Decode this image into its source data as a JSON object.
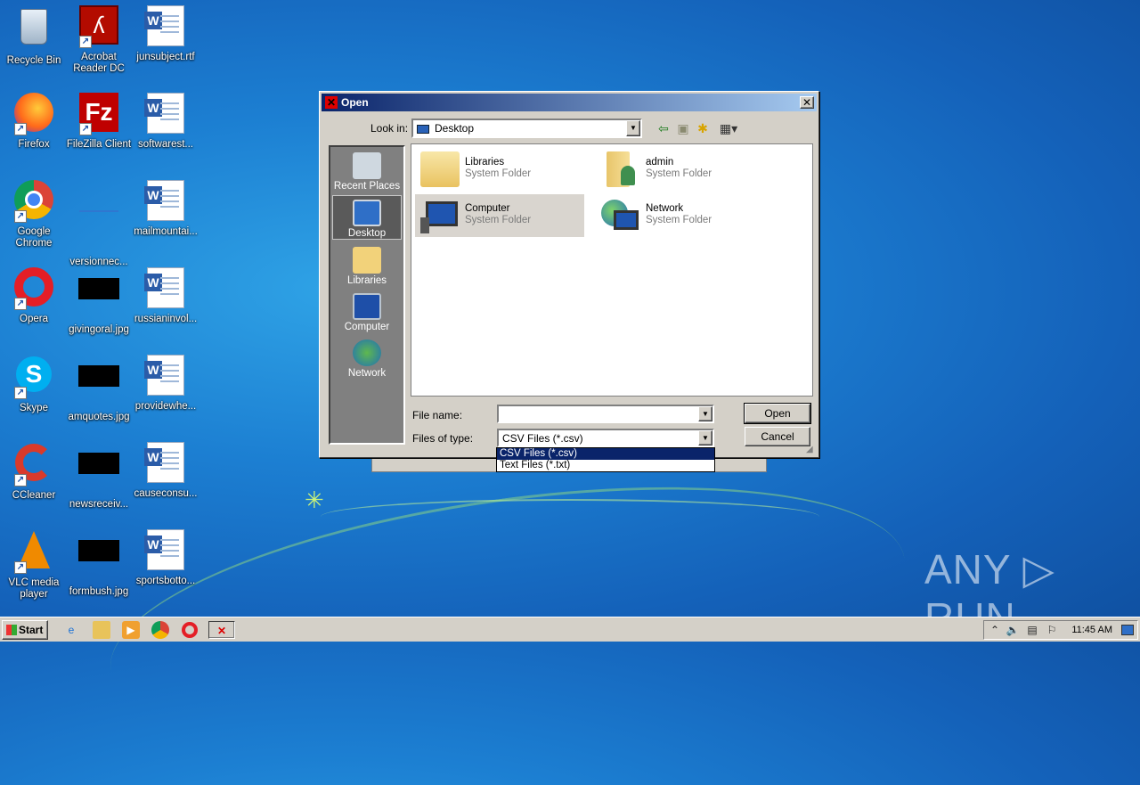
{
  "desktop": {
    "icons": [
      {
        "label": "Recycle Bin"
      },
      {
        "label": "Acrobat Reader DC"
      },
      {
        "label": "junsubject.rtf"
      },
      {
        "label": "Firefox"
      },
      {
        "label": "FileZilla Client"
      },
      {
        "label": "softwarest..."
      },
      {
        "label": "Google Chrome"
      },
      {
        "label": "versionnec..."
      },
      {
        "label": "mailmountai..."
      },
      {
        "label": "Opera"
      },
      {
        "label": "givingoral.jpg"
      },
      {
        "label": "russianinvol..."
      },
      {
        "label": "Skype"
      },
      {
        "label": "amquotes.jpg"
      },
      {
        "label": "providewhe..."
      },
      {
        "label": "CCleaner"
      },
      {
        "label": "newsreceiv..."
      },
      {
        "label": "causeconsu..."
      },
      {
        "label": "VLC media player"
      },
      {
        "label": "formbush.jpg"
      },
      {
        "label": "sportsbotto..."
      }
    ]
  },
  "dialog": {
    "title": "Open",
    "close_label": "✕",
    "look_in_label": "Look in:",
    "look_in_value": "Desktop",
    "places": [
      {
        "label": "Recent Places"
      },
      {
        "label": "Desktop"
      },
      {
        "label": "Libraries"
      },
      {
        "label": "Computer"
      },
      {
        "label": "Network"
      }
    ],
    "files": [
      {
        "name": "Libraries",
        "type": "System Folder"
      },
      {
        "name": "admin",
        "type": "System Folder"
      },
      {
        "name": "Computer",
        "type": "System Folder"
      },
      {
        "name": "Network",
        "type": "System Folder"
      }
    ],
    "file_name_label": "File name:",
    "file_name_value": "",
    "files_of_type_label": "Files of type:",
    "files_of_type_value": "CSV Files (*.csv)",
    "type_options": [
      "CSV Files (*.csv)",
      "Text Files (*.txt)"
    ],
    "open_button": "Open",
    "cancel_button": "Cancel"
  },
  "taskbar": {
    "start_label": "Start",
    "clock": "11:45 AM"
  },
  "watermark": "ANY ▷ RUN"
}
